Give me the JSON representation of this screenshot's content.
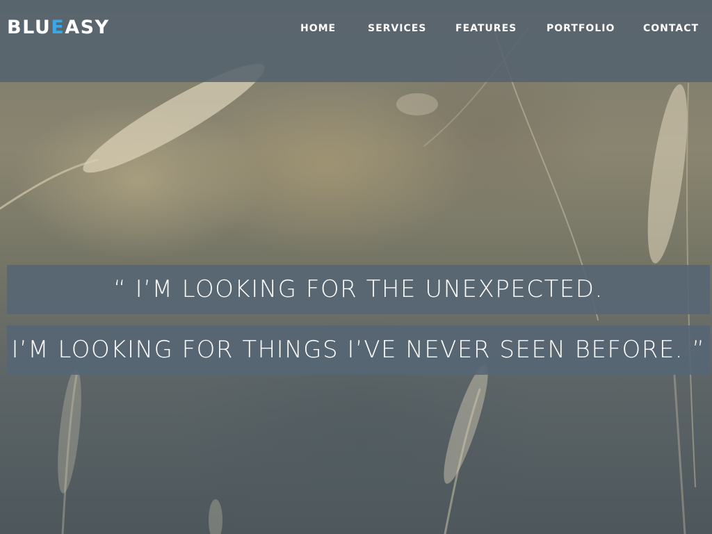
{
  "brand": {
    "prefix": "BLU",
    "accent": "E",
    "suffix": "ASY",
    "accent_color": "#3aa8e8"
  },
  "nav": {
    "items": [
      {
        "label": "HOME"
      },
      {
        "label": "SERVICES"
      },
      {
        "label": "FEATURES"
      },
      {
        "label": "PORTFOLIO"
      },
      {
        "label": "CONTACT"
      }
    ]
  },
  "hero": {
    "background": "blurred-wheat-field-photo",
    "quote_line_1": "“ I’M LOOKING FOR THE UNEXPECTED.",
    "quote_line_2": "I’M LOOKING FOR THINGS I’VE NEVER SEEN BEFORE. ”"
  }
}
